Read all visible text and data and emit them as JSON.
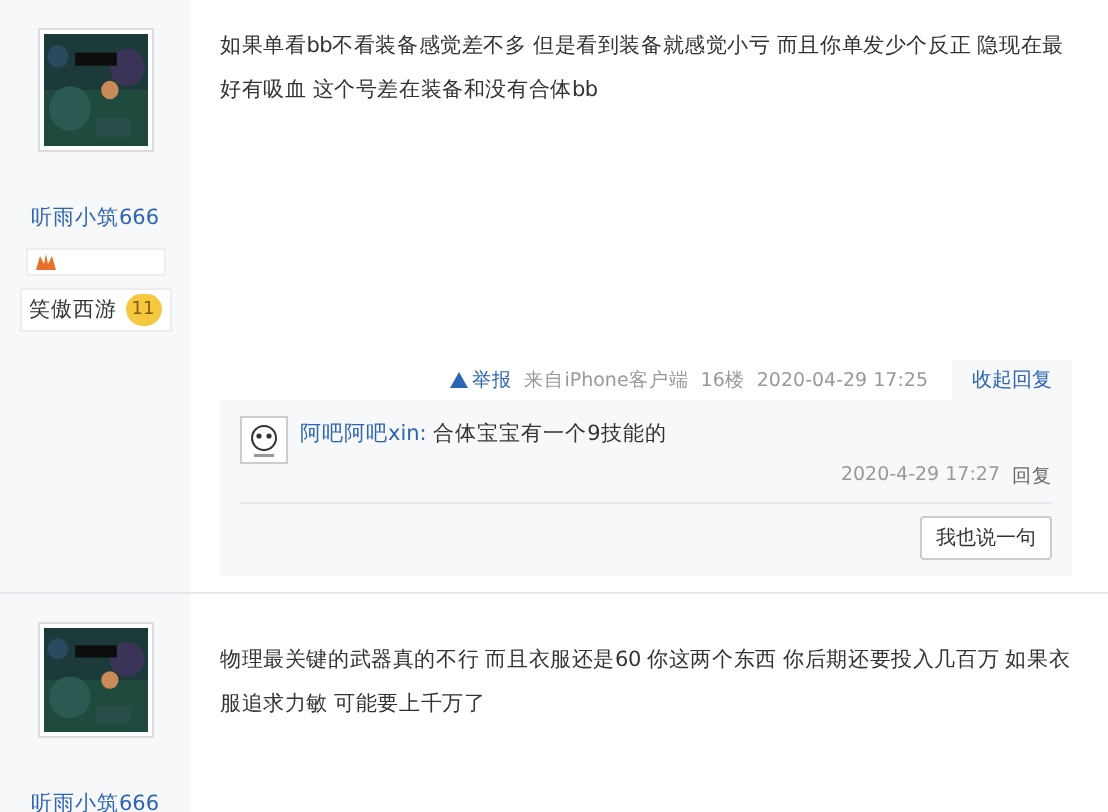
{
  "posts": [
    {
      "avatar": {
        "kind": "picture"
      },
      "username": "听雨小筑666",
      "badges": [
        {
          "kind": "icon"
        },
        {
          "kind": "level",
          "label": "笑傲西游",
          "level_text": "11"
        }
      ],
      "content": "如果单看bb不看装备感觉差不多 但是看到装备就感觉小亏 而且你单发少个反正 隐现在最好有吸血 这个号差在装备和没有合体bb",
      "footer": {
        "report": "举报",
        "source": "来自iPhone客户端",
        "floor": "16楼",
        "time": "2020-04-29 17:25",
        "toggle": "收起回复"
      },
      "replies": [
        {
          "user": "阿吧阿吧xin:",
          "text": "合体宝宝有一个9技能的",
          "time": "2020-4-29 17:27",
          "action": "回复"
        }
      ],
      "reply_button": "我也说一句"
    },
    {
      "avatar": {
        "kind": "picture"
      },
      "username": "听雨小筑666",
      "content": "物理最关键的武器真的不行 而且衣服还是60 你这两个东西 你后期还要投入几百万 如果衣服追求力敏 可能要上千万了"
    }
  ]
}
